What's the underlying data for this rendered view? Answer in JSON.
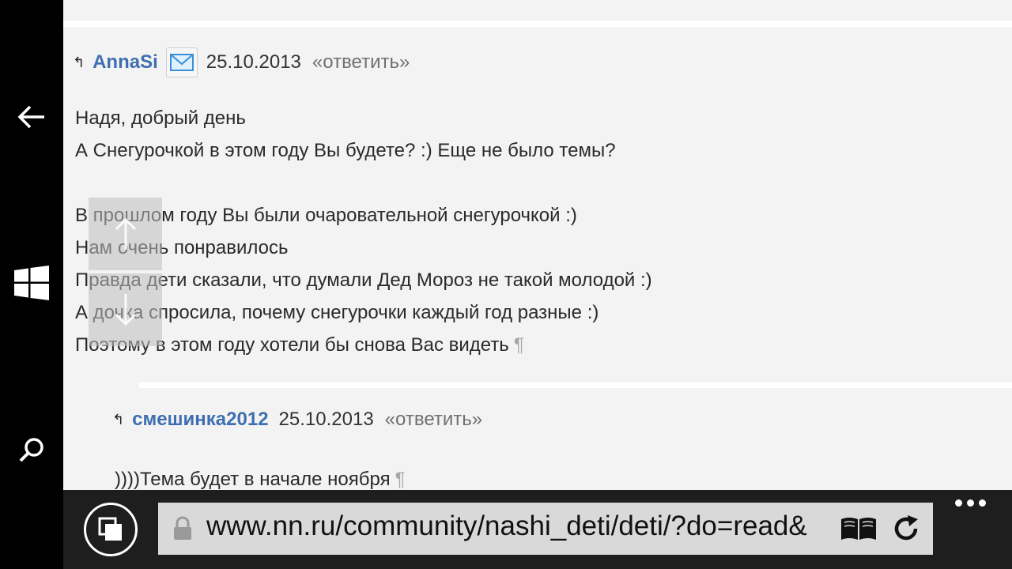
{
  "comments": [
    {
      "author": "AnnaSi",
      "date": "25.10.2013",
      "reply": "«ответить»",
      "lines": [
        "Надя, добрый день",
        "А Снегурочкой в этом году Вы будете? :) Еще не было темы?",
        "",
        "В прошлом году Вы были очаровательной снегурочкой :)",
        "Нам очень понравилось",
        "Правда дети сказали, что думали Дед Мороз не такой молодой :)",
        "А дочка спросила, почему снегурочки каждый год разные :)",
        "Поэтому в этом году хотели бы снова Вас видеть"
      ]
    },
    {
      "author": "смешинка2012",
      "date": "25.10.2013",
      "reply": "«ответить»",
      "lines": [
        "))))Тема будет в начале ноября"
      ]
    }
  ],
  "pilcrow": "¶",
  "reply_arrow": "↰",
  "address_bar": {
    "url": "www.nn.ru/community/nashi_deti/deti/?do=read&"
  },
  "icons": {
    "back": "back-arrow-icon",
    "start": "windows-logo-icon",
    "search": "search-icon",
    "mail": "mail-icon",
    "scroll_up": "arrow-up-icon",
    "scroll_down": "arrow-down-icon",
    "tabs": "tabs-icon",
    "lock": "lock-icon",
    "reader": "reading-view-icon",
    "refresh": "refresh-icon",
    "more": "more-icon"
  },
  "colors": {
    "author": "#3f6fb0",
    "page_bg": "#f3f3f3",
    "system_bar": "#000000",
    "app_bar": "#1e1e1e",
    "url_box": "#d9d9d9"
  }
}
